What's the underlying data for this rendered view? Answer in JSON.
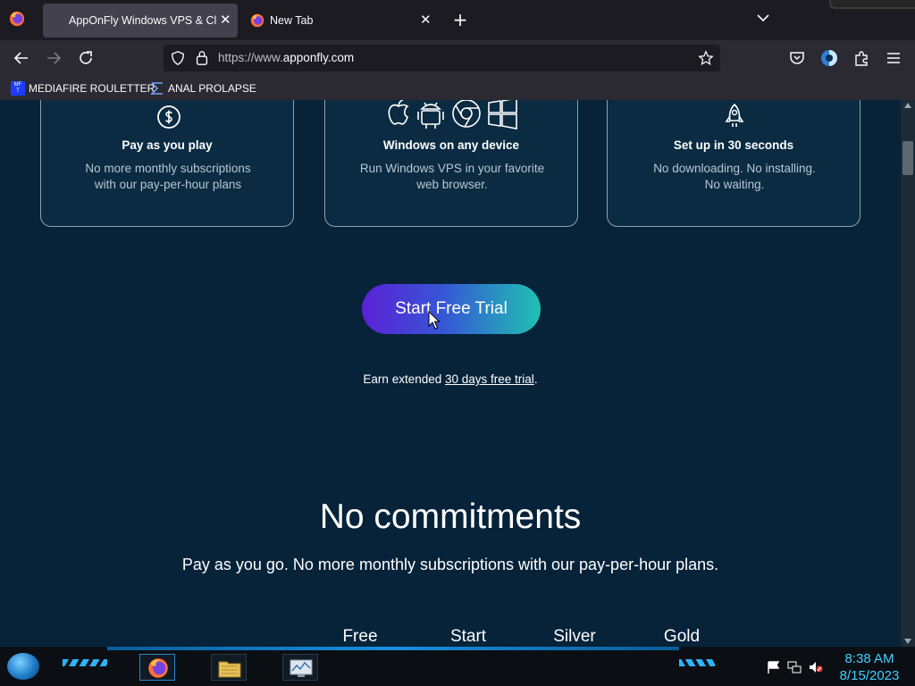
{
  "browser": {
    "tabs": [
      {
        "title": "AppOnFly Windows VPS & Clo",
        "active": true
      },
      {
        "title": "New Tab",
        "active": false
      }
    ],
    "new_tab_symbol": "+",
    "url_prefix": "https://www.",
    "url_host": "apponfly.com",
    "bookmarks": [
      {
        "label": "MEDIAFIRE ROULETTER",
        "icon_text": "MF\nT"
      },
      {
        "label": "ANAL PROLAPSE"
      }
    ]
  },
  "features": [
    {
      "title": "Pay as you play",
      "desc_line1": "No more monthly subscriptions",
      "desc_line2": "with our pay-per-hour plans",
      "icon": "dollar-coin-icon"
    },
    {
      "title": "Windows on any device",
      "desc_line1": "Run Windows VPS in your favorite",
      "desc_line2": "web browser.",
      "icon": "platforms-icon"
    },
    {
      "title": "Set up in 30 seconds",
      "desc_line1": "No downloading. No installing.",
      "desc_line2": "No waiting.",
      "icon": "rocket-icon"
    }
  ],
  "cta": {
    "label": "Start Free Trial"
  },
  "trial_line": {
    "prefix": "Earn extended ",
    "link": "30 days free trial",
    "suffix": "."
  },
  "commitments": {
    "heading": "No commitments",
    "subheading": "Pay as you go. No more monthly subscriptions with our pay-per-hour plans."
  },
  "plans": [
    "Free",
    "Start",
    "Silver",
    "Gold"
  ],
  "taskbar": {
    "time": "8:38 AM",
    "date": "8/15/2023"
  },
  "colors": {
    "page_bg": "#06233a",
    "cta_start": "#5b21d6",
    "cta_end": "#1fc1b0",
    "clock": "#3fd0ff"
  }
}
